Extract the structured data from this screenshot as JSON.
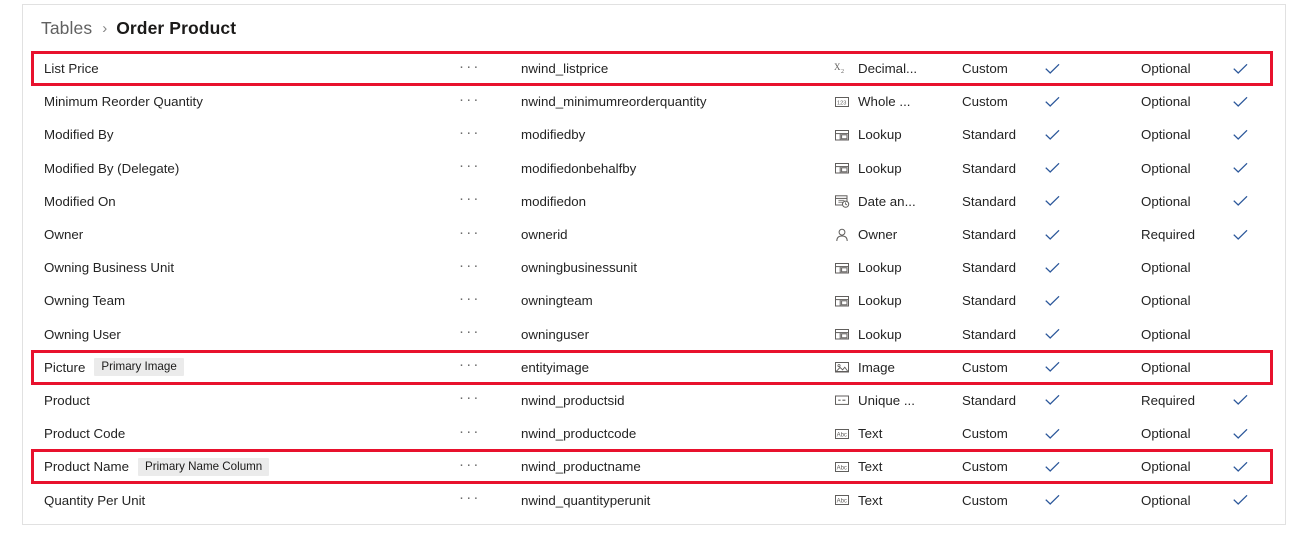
{
  "breadcrumb": {
    "root": "Tables",
    "separator": "›",
    "current": "Order Product"
  },
  "colors": {
    "highlight": "#e8112d",
    "checkmark": "#2b579a",
    "badge_bg": "#ebebeb",
    "panel_border": "#e1e1e1",
    "text": "#242424",
    "muted_text": "#616161"
  },
  "icons": {
    "ellipsis": "more-options-icon",
    "check": "checkmark-icon"
  },
  "grid": {
    "ellipsis_glyph": "···",
    "rows": [
      {
        "display_name": "List Price",
        "badge": "",
        "logical_name": "nwind_listprice",
        "data_type": "Decimal...",
        "type_icon": "decimal-number-icon",
        "type": "Custom",
        "customizable": true,
        "required_level": "Optional",
        "searchable": true,
        "highlighted": true
      },
      {
        "display_name": "Minimum Reorder Quantity",
        "badge": "",
        "logical_name": "nwind_minimumreorderquantity",
        "data_type": "Whole ...",
        "type_icon": "whole-number-icon",
        "type": "Custom",
        "customizable": true,
        "required_level": "Optional",
        "searchable": true,
        "highlighted": false
      },
      {
        "display_name": "Modified By",
        "badge": "",
        "logical_name": "modifiedby",
        "data_type": "Lookup",
        "type_icon": "lookup-icon",
        "type": "Standard",
        "customizable": true,
        "required_level": "Optional",
        "searchable": true,
        "highlighted": false
      },
      {
        "display_name": "Modified By (Delegate)",
        "badge": "",
        "logical_name": "modifiedonbehalfby",
        "data_type": "Lookup",
        "type_icon": "lookup-icon",
        "type": "Standard",
        "customizable": true,
        "required_level": "Optional",
        "searchable": true,
        "highlighted": false
      },
      {
        "display_name": "Modified On",
        "badge": "",
        "logical_name": "modifiedon",
        "data_type": "Date an...",
        "type_icon": "date-and-time-icon",
        "type": "Standard",
        "customizable": true,
        "required_level": "Optional",
        "searchable": true,
        "highlighted": false
      },
      {
        "display_name": "Owner",
        "badge": "",
        "logical_name": "ownerid",
        "data_type": "Owner",
        "type_icon": "owner-person-icon",
        "type": "Standard",
        "customizable": true,
        "required_level": "Required",
        "searchable": true,
        "highlighted": false
      },
      {
        "display_name": "Owning Business Unit",
        "badge": "",
        "logical_name": "owningbusinessunit",
        "data_type": "Lookup",
        "type_icon": "lookup-icon",
        "type": "Standard",
        "customizable": true,
        "required_level": "Optional",
        "searchable": false,
        "highlighted": false
      },
      {
        "display_name": "Owning Team",
        "badge": "",
        "logical_name": "owningteam",
        "data_type": "Lookup",
        "type_icon": "lookup-icon",
        "type": "Standard",
        "customizable": true,
        "required_level": "Optional",
        "searchable": false,
        "highlighted": false
      },
      {
        "display_name": "Owning User",
        "badge": "",
        "logical_name": "owninguser",
        "data_type": "Lookup",
        "type_icon": "lookup-icon",
        "type": "Standard",
        "customizable": true,
        "required_level": "Optional",
        "searchable": false,
        "highlighted": false
      },
      {
        "display_name": "Picture",
        "badge": "Primary Image",
        "logical_name": "entityimage",
        "data_type": "Image",
        "type_icon": "image-icon",
        "type": "Custom",
        "customizable": true,
        "required_level": "Optional",
        "searchable": false,
        "highlighted": true
      },
      {
        "display_name": "Product",
        "badge": "",
        "logical_name": "nwind_productsid",
        "data_type": "Unique ...",
        "type_icon": "unique-identifier-icon",
        "type": "Standard",
        "customizable": true,
        "required_level": "Required",
        "searchable": true,
        "highlighted": false
      },
      {
        "display_name": "Product Code",
        "badge": "",
        "logical_name": "nwind_productcode",
        "data_type": "Text",
        "type_icon": "text-abc-icon",
        "type": "Custom",
        "customizable": true,
        "required_level": "Optional",
        "searchable": true,
        "highlighted": false
      },
      {
        "display_name": "Product Name",
        "badge": "Primary Name Column",
        "logical_name": "nwind_productname",
        "data_type": "Text",
        "type_icon": "text-abc-icon",
        "type": "Custom",
        "customizable": true,
        "required_level": "Optional",
        "searchable": true,
        "highlighted": true
      },
      {
        "display_name": "Quantity Per Unit",
        "badge": "",
        "logical_name": "nwind_quantityperunit",
        "data_type": "Text",
        "type_icon": "text-abc-icon",
        "type": "Custom",
        "customizable": true,
        "required_level": "Optional",
        "searchable": true,
        "highlighted": false
      }
    ]
  }
}
